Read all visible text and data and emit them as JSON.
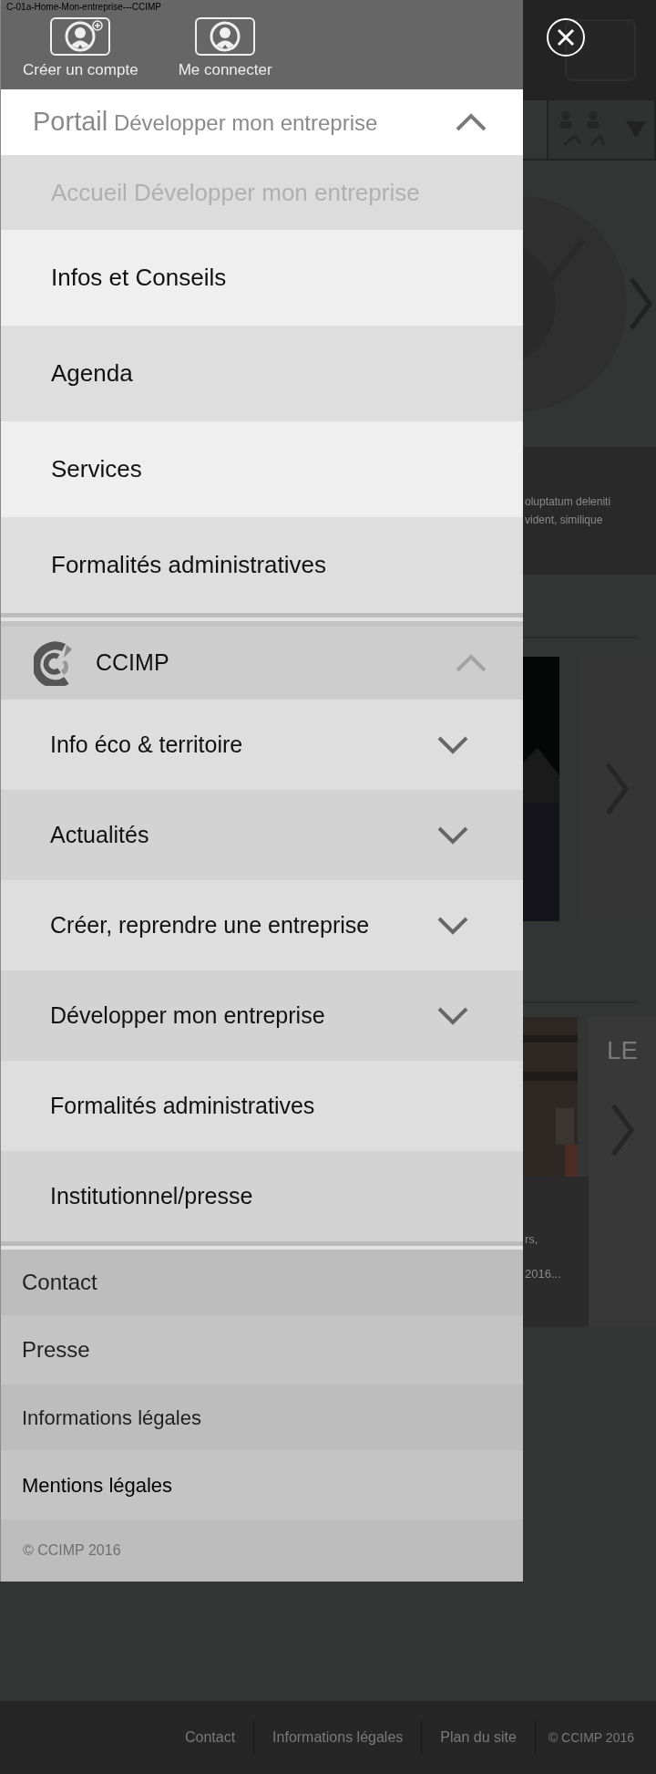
{
  "doc_label": "C-01a-Home-Mon-entreprise---CCIMP",
  "account_actions": [
    {
      "label": "Créer un compte",
      "kind": "create"
    },
    {
      "label": "Me connecter",
      "kind": "login"
    }
  ],
  "portal": {
    "prefix": "Portail",
    "title": "Développer mon entreprise",
    "expanded": true,
    "items": [
      {
        "label": "Accueil Développer mon entreprise",
        "selected": true
      },
      {
        "label": "Infos et Conseils",
        "selected": false
      },
      {
        "label": "Agenda",
        "selected": false
      },
      {
        "label": "Services",
        "selected": false
      },
      {
        "label": "Formalités administratives",
        "selected": false
      }
    ]
  },
  "ccimp": {
    "title": "CCIMP",
    "expanded": true,
    "items": [
      {
        "label": "Info éco & territoire",
        "kind": "expandable",
        "expanded": false
      },
      {
        "label": "Actualités",
        "kind": "expandable",
        "expanded": false
      },
      {
        "label": "Créer, reprendre une entreprise",
        "kind": "expandable",
        "expanded": false
      },
      {
        "label": "Développer mon entreprise",
        "kind": "expandable",
        "expanded": false
      },
      {
        "label": "Formalités administratives",
        "kind": "link"
      },
      {
        "label": "Institutionnel/presse",
        "kind": "link"
      }
    ]
  },
  "footer_links": [
    "Contact",
    "Presse",
    "Informations légales",
    "Mentions légales"
  ],
  "copyright": "© CCIMP 2016",
  "background_page": {
    "teaser_lines": [
      "oluptatum deleniti",
      "vident, similique"
    ],
    "card_heading": "LE",
    "card_lines": [
      "rs,",
      "2016..."
    ],
    "footer_links": [
      "Contact",
      "Informations légales",
      "Plan du site"
    ],
    "footer_copyright": "© CCIMP 2016"
  }
}
